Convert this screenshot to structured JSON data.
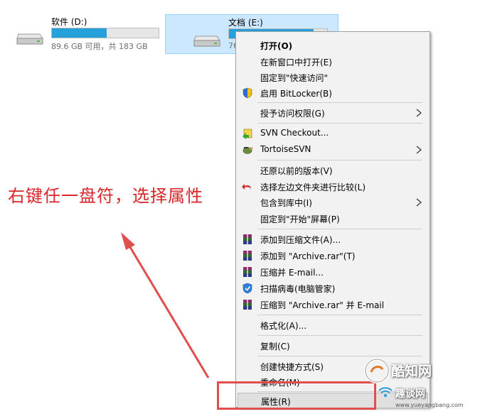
{
  "drives": [
    {
      "name": "软件 (D:)",
      "info": "89.6 GB 可用，共 183 GB",
      "fill_fraction": 0.51
    },
    {
      "name": "文档 (E:)",
      "info": "76",
      "fill_fraction": 0.86
    }
  ],
  "annotation": "右键任一盘符，选择属性",
  "menu": {
    "items": [
      {
        "label": "打开(O)",
        "bold": true,
        "icon": ""
      },
      {
        "label": "在新窗口中打开(E)",
        "icon": ""
      },
      {
        "label": "固定到\"快速访问\"",
        "icon": ""
      },
      {
        "label": "启用 BitLocker(B)",
        "icon": "bitlocker-shield-icon"
      },
      {
        "label": "授予访问权限(G)",
        "icon": "",
        "submenu": true
      },
      {
        "label": "SVN Checkout...",
        "icon": "svn-checkout-icon"
      },
      {
        "label": "TortoiseSVN",
        "icon": "tortoisesvn-icon",
        "submenu": true
      },
      {
        "label": "还原以前的版本(V)",
        "icon": ""
      },
      {
        "label": "选择左边文件夹进行比较(L)",
        "icon": "compare-undo-icon"
      },
      {
        "label": "包含到库中(I)",
        "icon": "",
        "submenu": true
      },
      {
        "label": "固定到\"开始\"屏幕(P)",
        "icon": ""
      },
      {
        "label": "添加到压缩文件(A)...",
        "icon": "winrar-icon"
      },
      {
        "label": "添加到 \"Archive.rar\"(T)",
        "icon": "winrar-icon"
      },
      {
        "label": "压缩并 E-mail...",
        "icon": "winrar-icon"
      },
      {
        "label": "扫描病毒(电脑管家)",
        "icon": "antivirus-shield-icon"
      },
      {
        "label": "压缩到 \"Archive.rar\" 并 E-mail",
        "icon": "winrar-icon"
      },
      {
        "label": "格式化(A)...",
        "icon": ""
      },
      {
        "label": "复制(C)",
        "icon": ""
      },
      {
        "label": "创建快捷方式(S)",
        "icon": ""
      },
      {
        "label": "重命名(M)",
        "icon": ""
      },
      {
        "label": "属性(R)",
        "icon": ""
      }
    ]
  },
  "watermark": {
    "line1": "酷知网",
    "line2": "趣谈网",
    "url": "www.yueyangbang.com"
  },
  "colors": {
    "accent": "#26a0da",
    "selection": "#cce8ff",
    "annotation": "#d9262a"
  }
}
